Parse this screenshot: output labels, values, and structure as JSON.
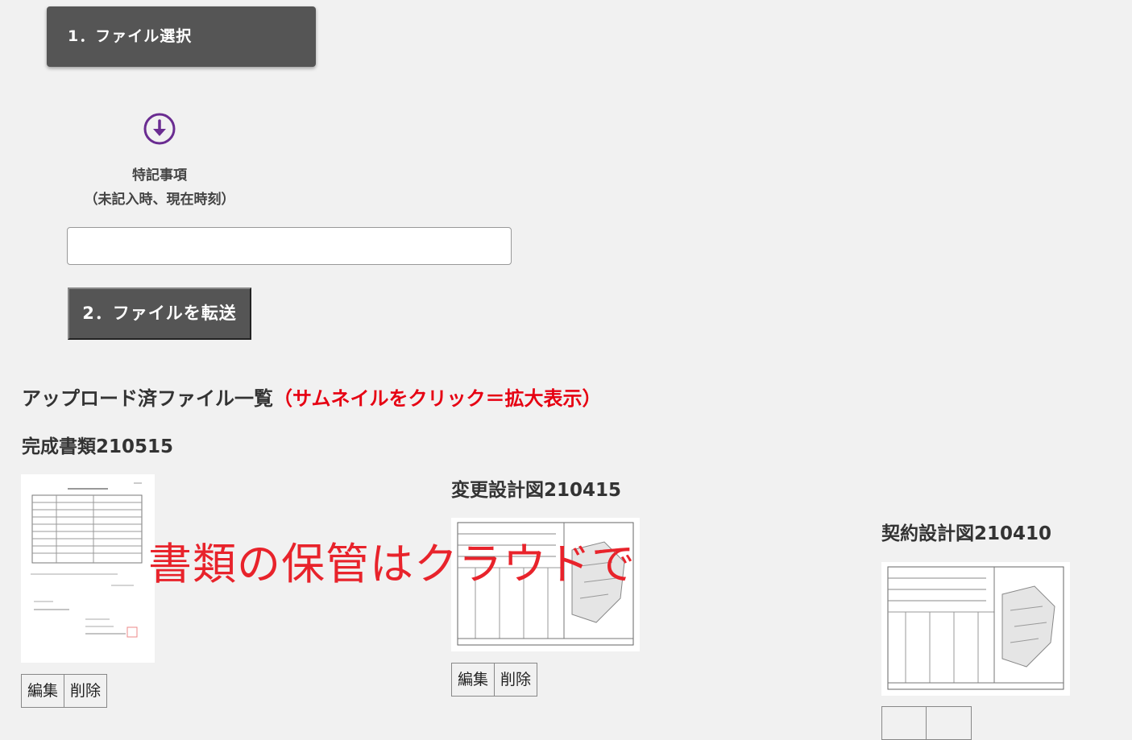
{
  "upload": {
    "select_button": "1．ファイル選択",
    "memo_label_line1": "特記事項",
    "memo_label_line2": "（未記入時、現在時刻）",
    "memo_value": "",
    "send_button": "2．ファイルを転送"
  },
  "uploaded": {
    "heading": "アップロード済ファイル一覧",
    "heading_hint": "（サムネイルをクリック＝拡大表示）",
    "files": [
      {
        "title": "完成書類210515",
        "edit_label": "編集",
        "delete_label": "削除"
      },
      {
        "title": "変更設計図210415",
        "edit_label": "編集",
        "delete_label": "削除"
      },
      {
        "title": "契約設計図210410",
        "edit_label": "",
        "delete_label": ""
      }
    ]
  },
  "overlay_text": "書類の保管はクラウドで",
  "colors": {
    "button_bg": "#555555",
    "accent_purple": "#6a2c91",
    "hint_red": "#e60012",
    "overlay_red": "#e8232b"
  }
}
